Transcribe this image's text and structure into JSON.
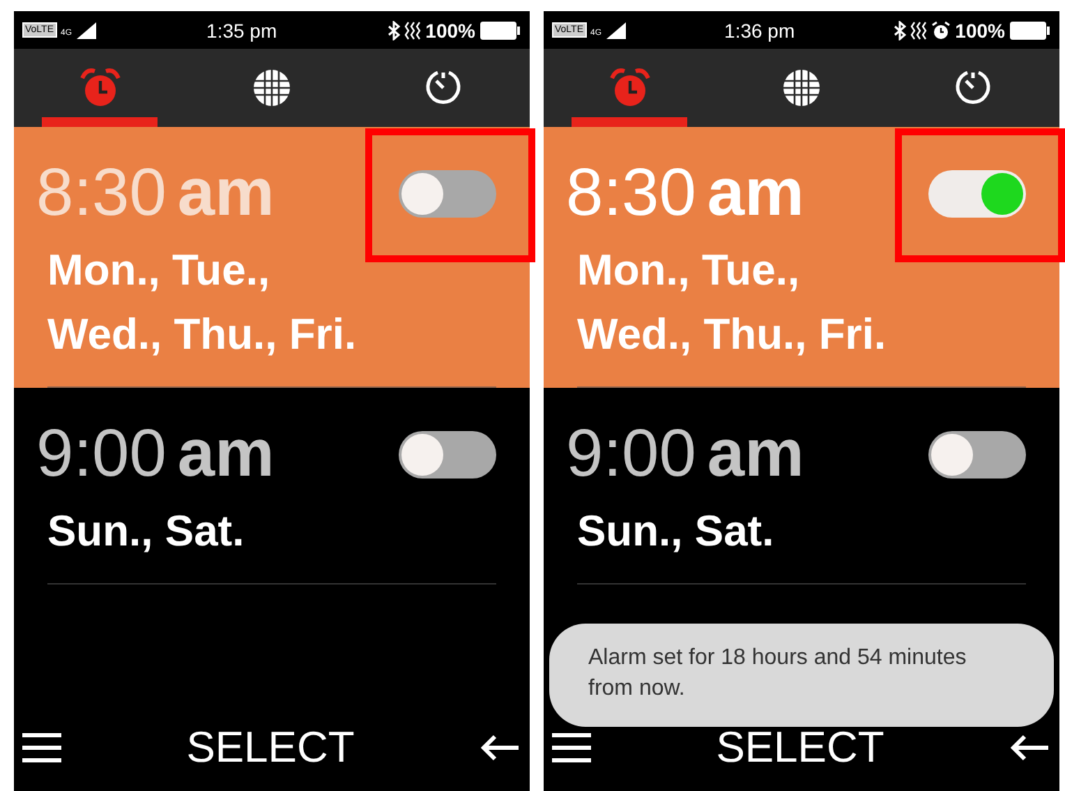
{
  "phones": [
    {
      "status_bar": {
        "network": "VoLTE",
        "generation": "4G",
        "time": "1:35 pm",
        "alarm_indicator": false,
        "battery": "100%"
      },
      "tabs": [
        {
          "kind": "alarm",
          "selected": true
        },
        {
          "kind": "world",
          "selected": false
        },
        {
          "kind": "timer",
          "selected": false
        }
      ],
      "alarms": [
        {
          "time": "8:30",
          "period": "am",
          "days": [
            "Mon., Tue.,",
            "Wed., Thu., Fri."
          ],
          "on": false,
          "selected": true,
          "annotated": true
        },
        {
          "time": "9:00",
          "period": "am",
          "days": [
            "Sun., Sat."
          ],
          "on": false,
          "selected": false,
          "annotated": false
        }
      ],
      "bottom_bar": {
        "center": "SELECT"
      }
    },
    {
      "status_bar": {
        "network": "VoLTE",
        "generation": "4G",
        "time": "1:36 pm",
        "alarm_indicator": true,
        "battery": "100%"
      },
      "tabs": [
        {
          "kind": "alarm",
          "selected": true
        },
        {
          "kind": "world",
          "selected": false
        },
        {
          "kind": "timer",
          "selected": false
        }
      ],
      "alarms": [
        {
          "time": "8:30",
          "period": "am",
          "days": [
            "Mon., Tue.,",
            "Wed., Thu., Fri."
          ],
          "on": true,
          "selected": true,
          "annotated": true
        },
        {
          "time": "9:00",
          "period": "am",
          "days": [
            "Sun., Sat."
          ],
          "on": false,
          "selected": false,
          "annotated": false
        }
      ],
      "toast": "Alarm set for 18 hours and 54 minutes from now.",
      "bottom_bar": {
        "center": "SELECT"
      }
    }
  ]
}
